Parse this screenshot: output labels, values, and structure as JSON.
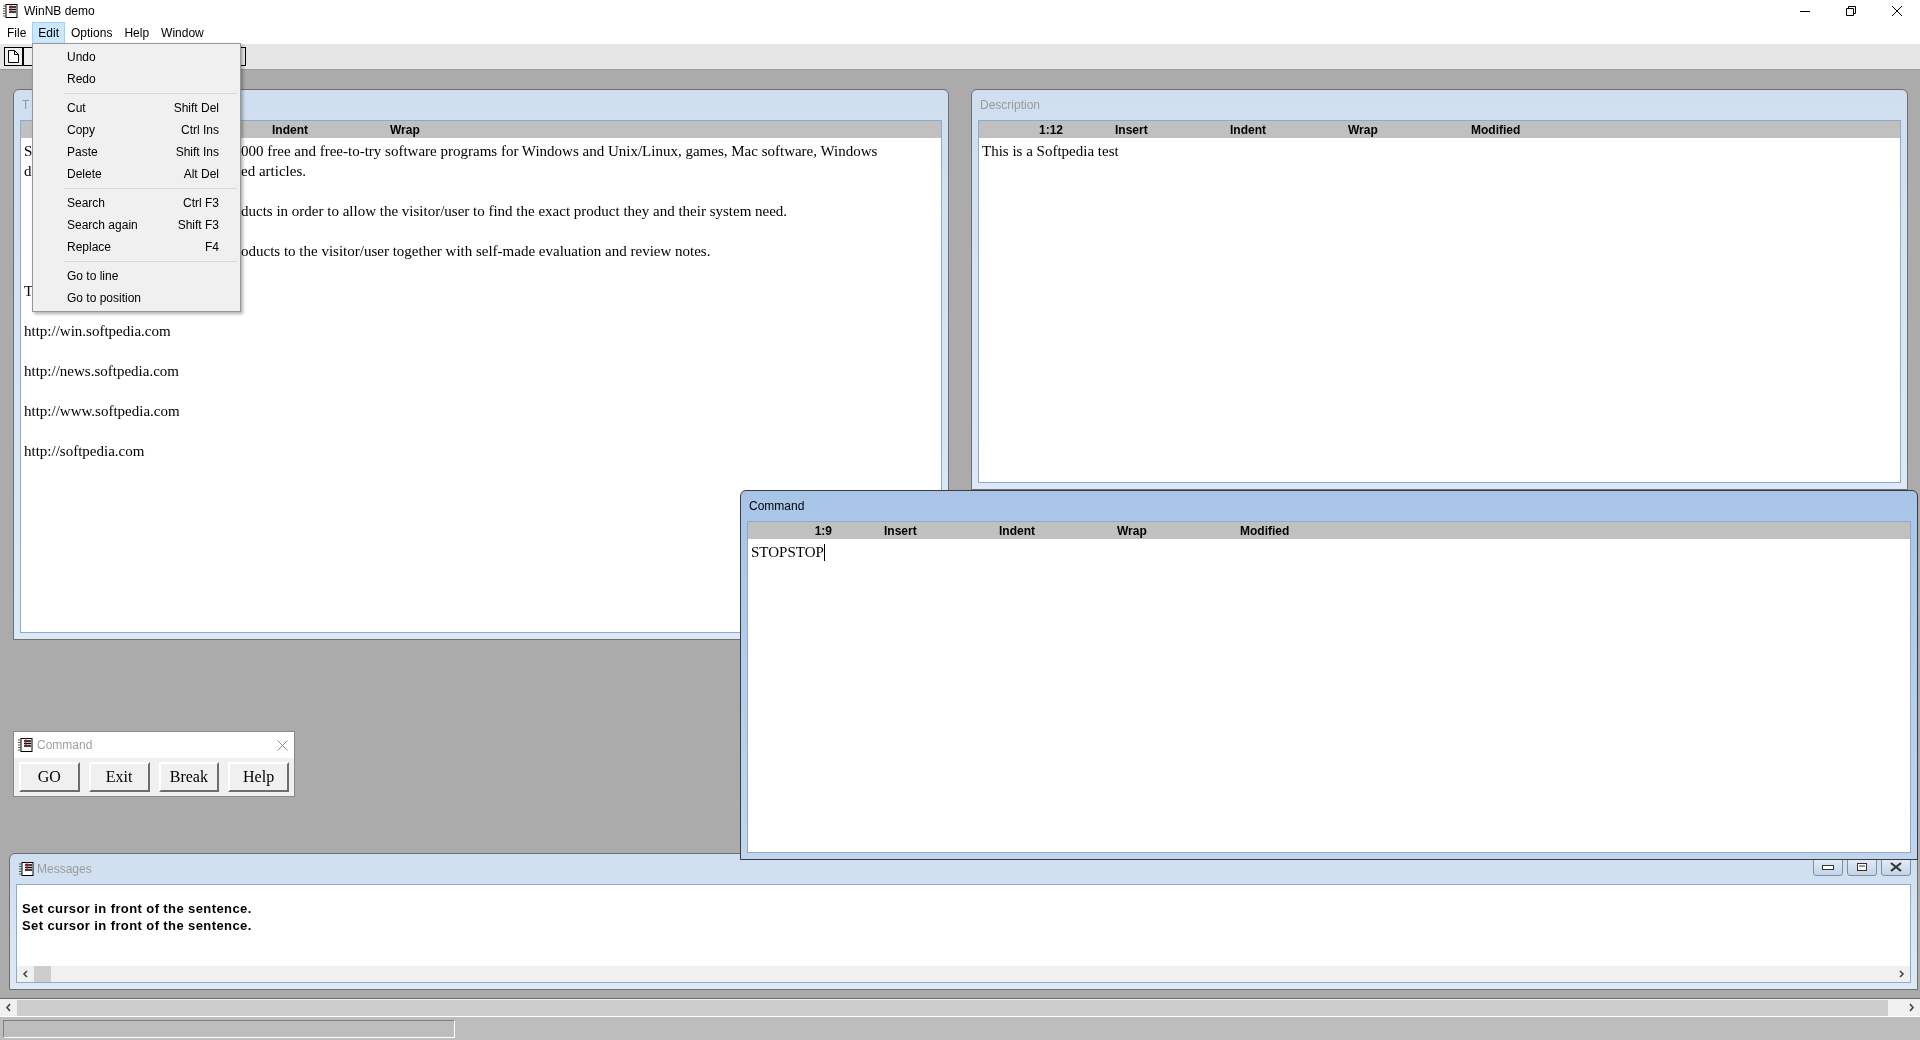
{
  "app": {
    "title": "WinNB demo"
  },
  "menu_bar": [
    {
      "label": "File",
      "selected": false
    },
    {
      "label": "Edit",
      "selected": true
    },
    {
      "label": "Options",
      "selected": false
    },
    {
      "label": "Help",
      "selected": false
    },
    {
      "label": "Window",
      "selected": false
    }
  ],
  "edit_menu": [
    {
      "kind": "item",
      "label": "Undo"
    },
    {
      "kind": "item",
      "label": "Redo"
    },
    {
      "kind": "separator"
    },
    {
      "kind": "item",
      "label": "Cut",
      "shortcut": "Shift Del"
    },
    {
      "kind": "item",
      "label": "Copy",
      "shortcut": "Ctrl Ins"
    },
    {
      "kind": "item",
      "label": "Paste",
      "shortcut": "Shift Ins"
    },
    {
      "kind": "item",
      "label": "Delete",
      "shortcut": "Alt Del"
    },
    {
      "kind": "separator"
    },
    {
      "kind": "item",
      "label": "Search",
      "shortcut": "Ctrl F3"
    },
    {
      "kind": "item",
      "label": "Search again",
      "shortcut": "Shift F3"
    },
    {
      "kind": "item",
      "label": "Replace",
      "shortcut": "F4"
    },
    {
      "kind": "separator"
    },
    {
      "kind": "item",
      "label": "Go to line"
    },
    {
      "kind": "item",
      "label": "Go to position"
    }
  ],
  "text_window": {
    "title": "T",
    "active": false,
    "status": {
      "indent": "Indent",
      "wrap": "Wrap"
    },
    "paragraphs": [
      [
        {
          "lead": "S",
          "tail": "000 free and free-to-try software programs for Windows and Unix/Linux, games, Mac software, Windows"
        },
        {
          "lead": "d",
          "tail": "ed articles."
        }
      ],
      [
        {
          "tail": "ducts in order to allow the visitor/user to find the exact product they and their system need."
        }
      ],
      [
        {
          "tail": "oducts to the visitor/user together with self-made evaluation and review notes."
        }
      ],
      [
        {
          "lead": "T"
        }
      ],
      [
        {
          "lead": "http://win.softpedia.com"
        }
      ],
      [
        {
          "lead": "http://news.softpedia.com"
        }
      ],
      [
        {
          "lead": "http://www.softpedia.com"
        }
      ],
      [
        {
          "lead": "http://softpedia.com"
        }
      ]
    ]
  },
  "description_window": {
    "title": "Description",
    "active": false,
    "status": {
      "position": "1:12",
      "insert": "Insert",
      "indent": "Indent",
      "wrap": "Wrap",
      "modified": "Modified"
    },
    "lines": [
      "This is a Softpedia test"
    ]
  },
  "command_toolbox": {
    "title": "Command",
    "buttons": [
      "GO",
      "Exit",
      "Break",
      "Help"
    ]
  },
  "command_window": {
    "title": "Command",
    "active": true,
    "status": {
      "position": "1:9",
      "insert": "Insert",
      "indent": "Indent",
      "wrap": "Wrap",
      "modified": "Modified"
    },
    "lines": [
      "STOPSTOP"
    ]
  },
  "messages_window": {
    "title": "Messages",
    "active": false,
    "lines": [
      "Set cursor in front of the sentence.",
      "Set cursor in front of the sentence."
    ]
  }
}
